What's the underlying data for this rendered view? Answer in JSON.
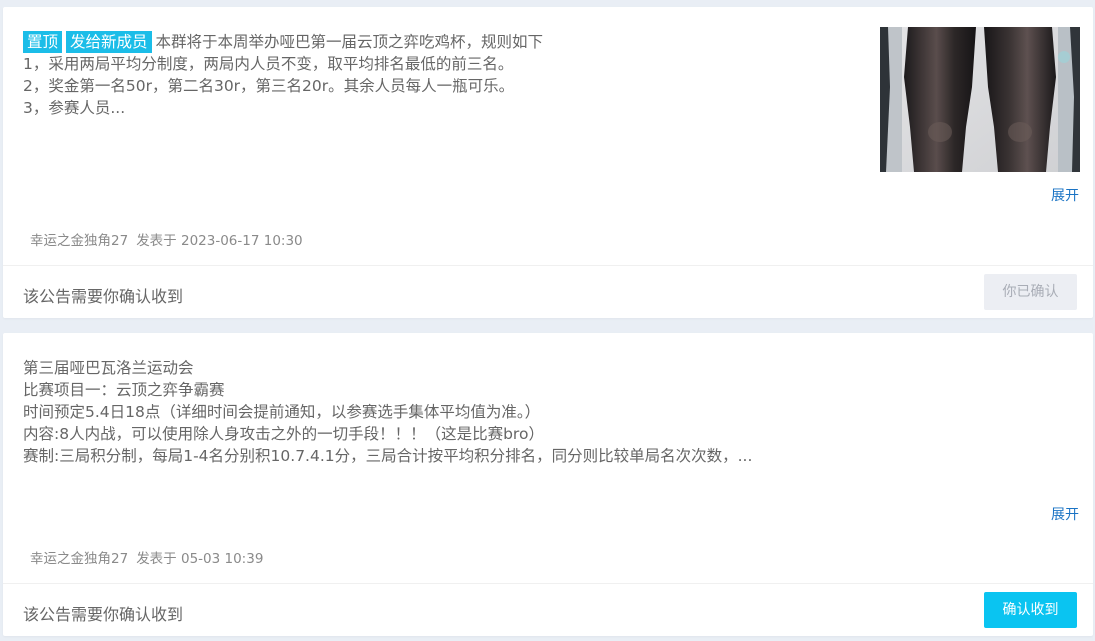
{
  "announcements": [
    {
      "tags": [
        "置顶",
        "发给新成员"
      ],
      "lines": [
        "本群将于本周举办哑巴第一届云顶之弈吃鸡杯，规则如下",
        "1，采用两局平均分制度，两局内人员不变，取平均排名最低的前三名。",
        "2，奖金第一名50r，第二名30r，第三名20r。其余人员每人一瓶可乐。",
        "3，参赛人员..."
      ],
      "expand_label": "展开",
      "author": "幸运之金独角27",
      "posted": "发表于 2023-06-17 10:30",
      "confirm_prompt": "该公告需要你确认收到",
      "button_label": "你已确认",
      "has_image": true
    },
    {
      "tags": [],
      "lines": [
        "第三届哑巴瓦洛兰运动会",
        "比赛项目一：云顶之弈争霸赛",
        "时间预定5.4日18点（详细时间会提前通知，以参赛选手集体平均值为准。）",
        "内容:8人内战，可以使用除人身攻击之外的一切手段！！！（这是比赛bro）",
        "赛制:三局积分制，每局1-4名分别积10.7.4.1分，三局合计按平均积分排名，同分则比较单局名次次数，..."
      ],
      "expand_label": "展开",
      "author": "幸运之金独角27",
      "posted": "发表于 05-03 10:39",
      "confirm_prompt": "该公告需要你确认收到",
      "button_label": "确认收到",
      "has_image": false
    }
  ],
  "colors": {
    "tag_bg": "#1bbde8",
    "confirm_bg": "#0ac4f1",
    "link": "#1a73c4"
  }
}
